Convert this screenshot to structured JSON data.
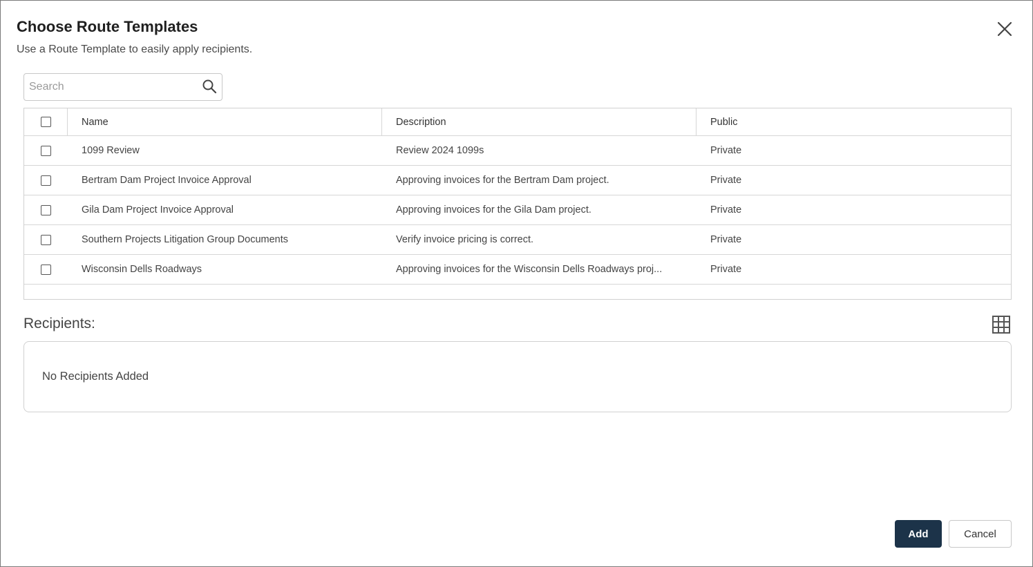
{
  "dialog": {
    "title": "Choose Route Templates",
    "subtitle": "Use a Route Template to easily apply recipients."
  },
  "search": {
    "placeholder": "Search",
    "value": ""
  },
  "table": {
    "columns": {
      "name": "Name",
      "description": "Description",
      "public": "Public"
    },
    "rows": [
      {
        "name": "1099 Review",
        "description": "Review 2024 1099s",
        "public": "Private"
      },
      {
        "name": "Bertram Dam Project Invoice Approval",
        "description": "Approving invoices for the Bertram Dam project.",
        "public": "Private"
      },
      {
        "name": "Gila Dam Project Invoice Approval",
        "description": "Approving invoices for the Gila Dam project.",
        "public": "Private"
      },
      {
        "name": "Southern Projects Litigation Group Documents",
        "description": "Verify invoice pricing is correct.",
        "public": "Private"
      },
      {
        "name": "Wisconsin Dells Roadways",
        "description": "Approving invoices for the Wisconsin Dells Roadways proj...",
        "public": "Private"
      }
    ]
  },
  "recipients": {
    "label": "Recipients:",
    "empty_text": "No Recipients Added"
  },
  "footer": {
    "add_label": "Add",
    "cancel_label": "Cancel"
  },
  "colors": {
    "primary_button": "#1c3349",
    "border": "#d0d0d0"
  }
}
